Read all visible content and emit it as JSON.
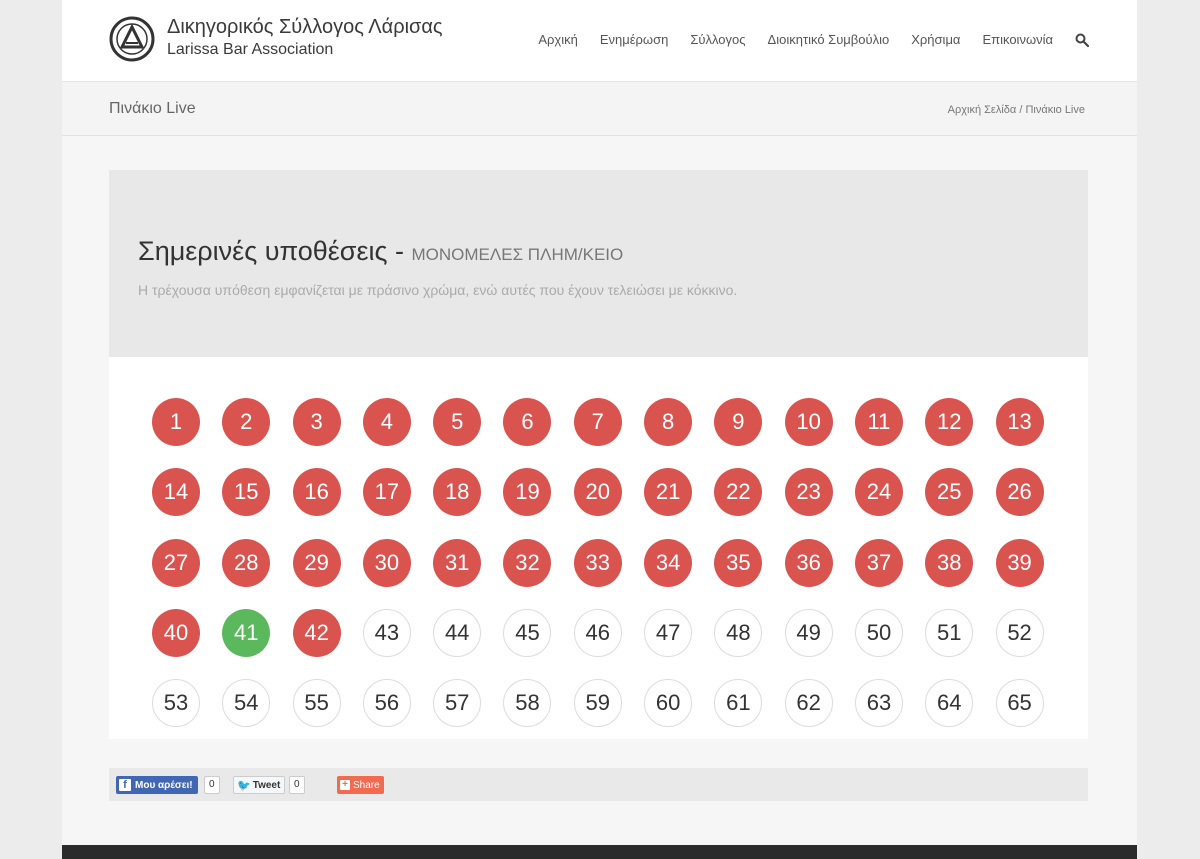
{
  "header": {
    "logo_title": "Δικηγορικός Σύλλογος Λάρισας",
    "logo_subtitle": "Larissa Bar Association",
    "nav": [
      "Αρχική",
      "Ενημέρωση",
      "Σύλλογος",
      "Διοικητικό Συμβούλιο",
      "Χρήσιμα",
      "Επικοινωνία"
    ]
  },
  "titlebar": {
    "title": "Πινάκιο Live",
    "breadcrumb_home": "Αρχική Σελίδα",
    "breadcrumb_sep": "/",
    "breadcrumb_current": "Πινάκιο Live"
  },
  "hero": {
    "heading": "Σημερινές υποθέσεις - ",
    "heading_sub": "ΜΟΝΟΜΕΛΕΣ ΠΛΗΜ/ΚΕΙΟ",
    "note": "Η τρέχουσα υπόθεση εμφανίζεται με πράσινο χρώμα, ενώ αυτές που έχουν τελειώσει με κόκκινο."
  },
  "board": {
    "colors": {
      "done": "#d9534f",
      "current": "#5cb85c",
      "pending": "#ffffff"
    },
    "cases": [
      {
        "n": "1",
        "s": "done"
      },
      {
        "n": "2",
        "s": "done"
      },
      {
        "n": "3",
        "s": "done"
      },
      {
        "n": "4",
        "s": "done"
      },
      {
        "n": "5",
        "s": "done"
      },
      {
        "n": "6",
        "s": "done"
      },
      {
        "n": "7",
        "s": "done"
      },
      {
        "n": "8",
        "s": "done"
      },
      {
        "n": "9",
        "s": "done"
      },
      {
        "n": "10",
        "s": "done"
      },
      {
        "n": "11",
        "s": "done"
      },
      {
        "n": "12",
        "s": "done"
      },
      {
        "n": "13",
        "s": "done"
      },
      {
        "n": "14",
        "s": "done"
      },
      {
        "n": "15",
        "s": "done"
      },
      {
        "n": "16",
        "s": "done"
      },
      {
        "n": "17",
        "s": "done"
      },
      {
        "n": "18",
        "s": "done"
      },
      {
        "n": "19",
        "s": "done"
      },
      {
        "n": "20",
        "s": "done"
      },
      {
        "n": "21",
        "s": "done"
      },
      {
        "n": "22",
        "s": "done"
      },
      {
        "n": "23",
        "s": "done"
      },
      {
        "n": "24",
        "s": "done"
      },
      {
        "n": "25",
        "s": "done"
      },
      {
        "n": "26",
        "s": "done"
      },
      {
        "n": "27",
        "s": "done"
      },
      {
        "n": "28",
        "s": "done"
      },
      {
        "n": "29",
        "s": "done"
      },
      {
        "n": "30",
        "s": "done"
      },
      {
        "n": "31",
        "s": "done"
      },
      {
        "n": "32",
        "s": "done"
      },
      {
        "n": "33",
        "s": "done"
      },
      {
        "n": "34",
        "s": "done"
      },
      {
        "n": "35",
        "s": "done"
      },
      {
        "n": "36",
        "s": "done"
      },
      {
        "n": "37",
        "s": "done"
      },
      {
        "n": "38",
        "s": "done"
      },
      {
        "n": "39",
        "s": "done"
      },
      {
        "n": "40",
        "s": "done"
      },
      {
        "n": "41",
        "s": "current"
      },
      {
        "n": "42",
        "s": "done"
      },
      {
        "n": "43",
        "s": "pending"
      },
      {
        "n": "44",
        "s": "pending"
      },
      {
        "n": "45",
        "s": "pending"
      },
      {
        "n": "46",
        "s": "pending"
      },
      {
        "n": "47",
        "s": "pending"
      },
      {
        "n": "48",
        "s": "pending"
      },
      {
        "n": "49",
        "s": "pending"
      },
      {
        "n": "50",
        "s": "pending"
      },
      {
        "n": "51",
        "s": "pending"
      },
      {
        "n": "52",
        "s": "pending"
      },
      {
        "n": "53",
        "s": "pending"
      },
      {
        "n": "54",
        "s": "pending"
      },
      {
        "n": "55",
        "s": "pending"
      },
      {
        "n": "56",
        "s": "pending"
      },
      {
        "n": "57",
        "s": "pending"
      },
      {
        "n": "58",
        "s": "pending"
      },
      {
        "n": "59",
        "s": "pending"
      },
      {
        "n": "60",
        "s": "pending"
      },
      {
        "n": "61",
        "s": "pending"
      },
      {
        "n": "62",
        "s": "pending"
      },
      {
        "n": "63",
        "s": "pending"
      },
      {
        "n": "64",
        "s": "pending"
      },
      {
        "n": "65",
        "s": "pending"
      }
    ]
  },
  "share": {
    "facebook_label": "Μου αρέσει!",
    "facebook_count": "0",
    "tweet_label": "Tweet",
    "tweet_count": "0",
    "share_label": "Share"
  }
}
